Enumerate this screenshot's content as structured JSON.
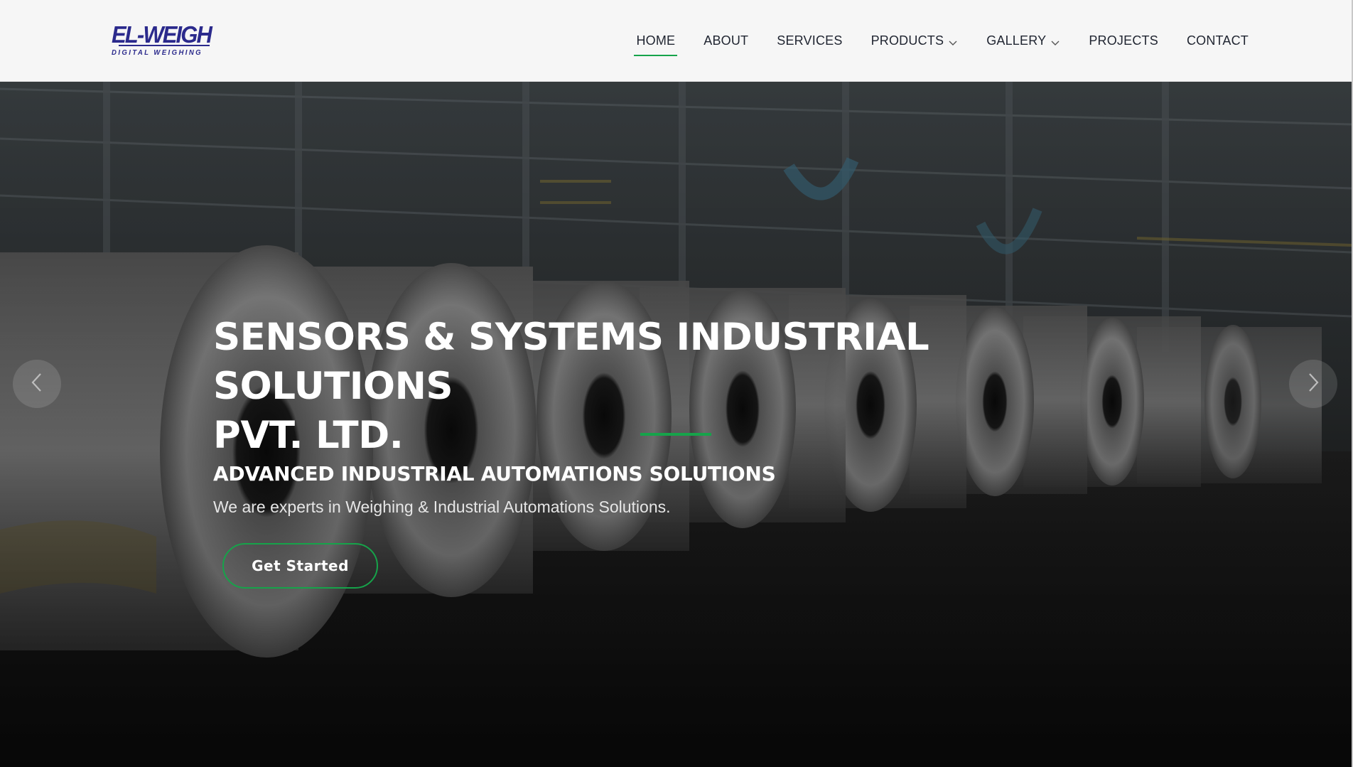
{
  "header": {
    "logo": {
      "text": "EL-WEIGH",
      "tagline": "DIGITAL WEIGHING",
      "color": "#2b2a8c"
    },
    "nav": [
      {
        "label": "HOME",
        "active": true
      },
      {
        "label": "ABOUT"
      },
      {
        "label": "SERVICES"
      },
      {
        "label": "PRODUCTS",
        "dropdown": true
      },
      {
        "label": "GALLERY",
        "dropdown": true
      },
      {
        "label": "PROJECTS"
      },
      {
        "label": "CONTACT"
      }
    ]
  },
  "hero": {
    "title_line1": "SENSORS & SYSTEMS INDUSTRIAL SOLUTIONS",
    "title_line2": "PVT. LTD.",
    "subtitle": "ADVANCED INDUSTRIAL AUTOMATIONS SOLUTIONS",
    "description": "We are experts in Weighing & Industrial Automations Solutions.",
    "cta_label": "Get Started",
    "prev_icon": "chevron-left-icon",
    "next_icon": "chevron-right-icon"
  },
  "colors": {
    "accent": "#16a34a",
    "header_bg": "#f6f6f6",
    "nav_text": "#1f2430"
  }
}
